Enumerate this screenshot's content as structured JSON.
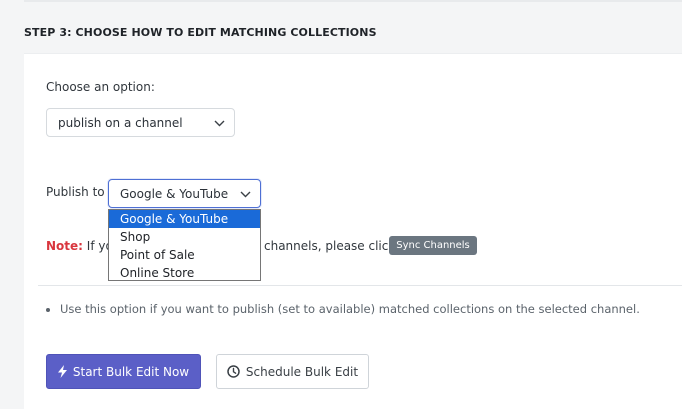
{
  "step_title": "STEP 3: CHOOSE HOW TO EDIT MATCHING COLLECTIONS",
  "choose": {
    "label": "Choose an option:",
    "selected": "publish on a channel"
  },
  "publish": {
    "label": "Publish to",
    "selected": "Google & YouTube",
    "options": [
      "Google & YouTube",
      "Shop",
      "Point of Sale",
      "Online Store"
    ]
  },
  "note": {
    "label": "Note:",
    "text_start": "If yo",
    "text_end": "channels, please click",
    "sync_button": "Sync Channels"
  },
  "info_bullet": "Use this option if you want to publish (set to available) matched collections on the selected channel.",
  "buttons": {
    "start": "Start Bulk Edit Now",
    "schedule": "Schedule Bulk Edit"
  },
  "colors": {
    "primary": "#5b5fc7",
    "note_red": "#d9363e",
    "selected_option": "#1a6ad8",
    "sync_button": "#6b7680"
  },
  "icons": {
    "start": "bolt-icon",
    "schedule": "clock-icon",
    "select": "chevron-down-icon"
  }
}
